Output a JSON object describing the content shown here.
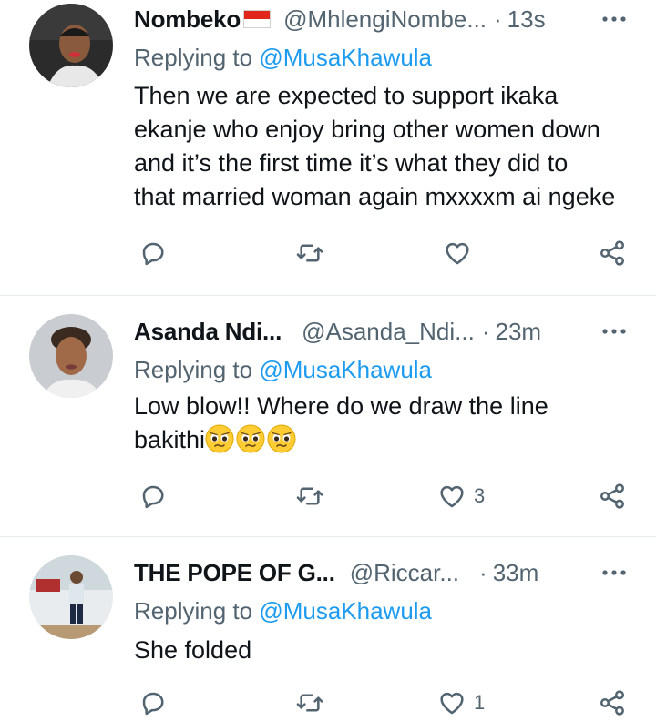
{
  "tweets": [
    {
      "name": "Nombeko",
      "handle": "@MhlengiNombe...",
      "separator": "·",
      "time": "13s",
      "replying_label": "Replying to",
      "replying_to": "@MusaKhawula",
      "lines": [
        "Then we are expected to support ikaka",
        "ekanje who enjoy bring other women down",
        "and it’s the first time it’s what they did to",
        "that married woman again mxxxxm ai ngeke"
      ],
      "like_count": ""
    },
    {
      "name": "Asanda Ndi...",
      "handle": "@Asanda_Ndi...",
      "separator": "·",
      "time": "23m",
      "replying_label": "Replying to",
      "replying_to": "@MusaKhawula",
      "lines": [
        "Low blow!! Where do we draw the line",
        "bakithi"
      ],
      "emojis": [
        "pleading-woozy-face",
        "pleading-woozy-face",
        "pleading-woozy-face"
      ],
      "like_count": "3"
    },
    {
      "name": "THE POPE OF G...",
      "handle": "@Riccar...",
      "separator": "·",
      "time": "33m",
      "replying_label": "Replying to",
      "replying_to": "@MusaKhawula",
      "lines": [
        "She folded"
      ],
      "like_count": "1"
    }
  ],
  "icons": [
    "reply-icon",
    "retweet-icon",
    "like-icon",
    "share-icon",
    "more-icon"
  ],
  "colors": {
    "text": "#0f1419",
    "muted": "#536471",
    "link": "#1d9bf0",
    "divider": "#e6ecf0"
  }
}
